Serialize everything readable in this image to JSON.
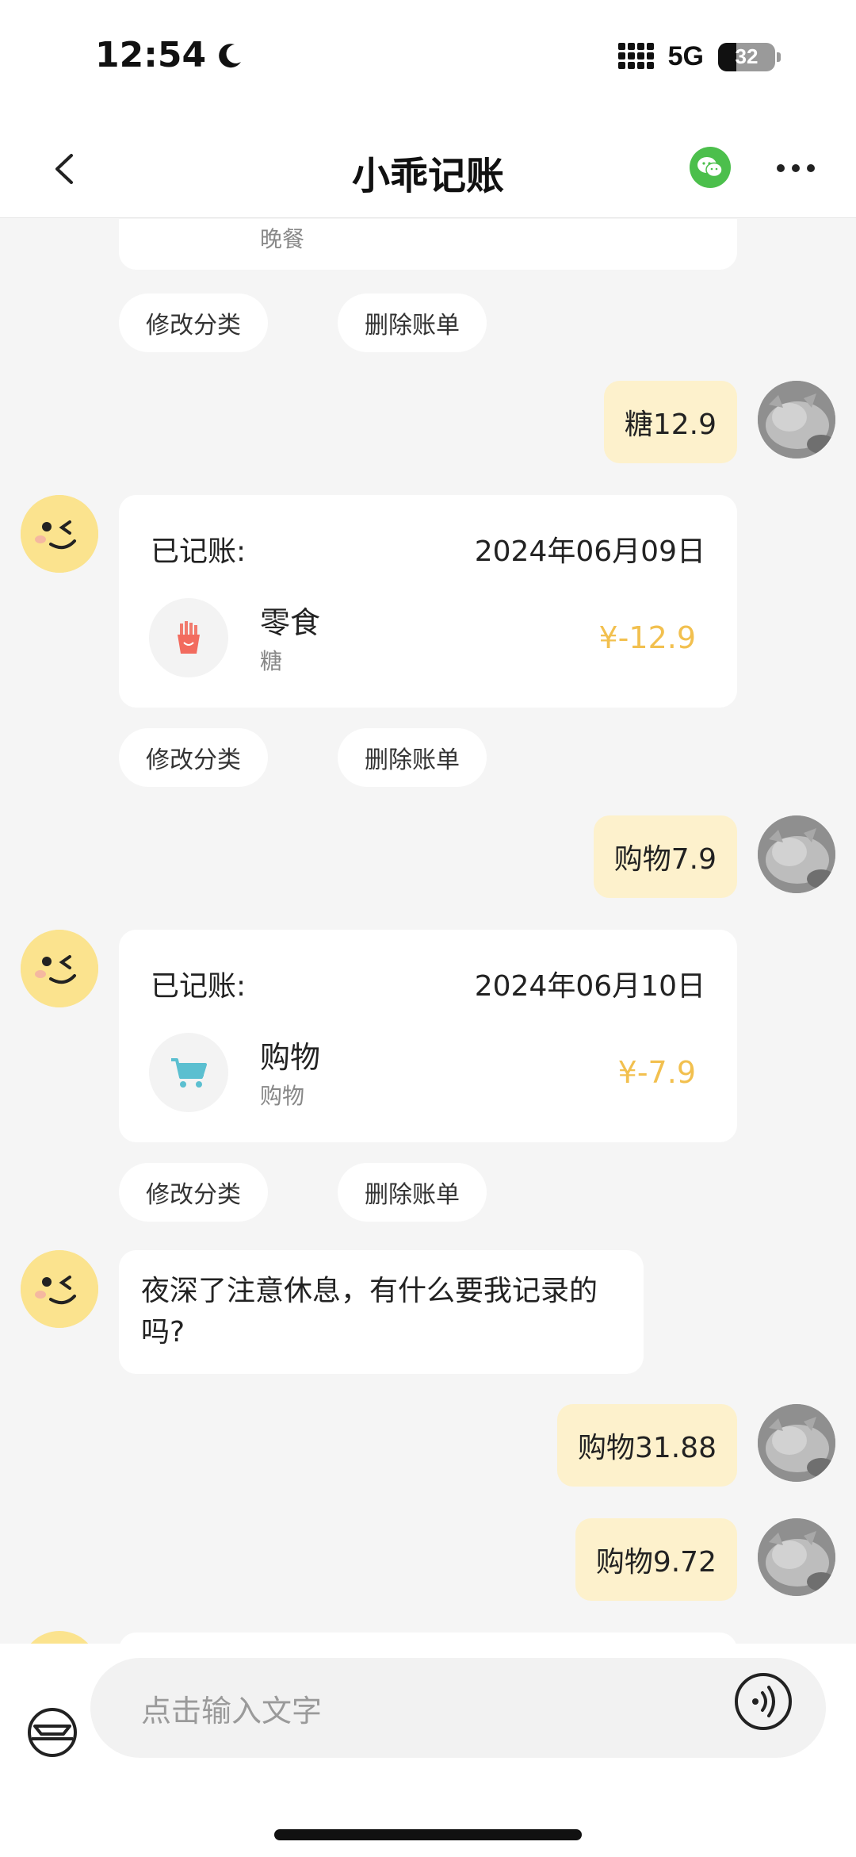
{
  "status_bar": {
    "time": "12:54",
    "network": "5G",
    "battery": "32",
    "battery_level": 0.32
  },
  "header": {
    "title": "小乖记账"
  },
  "messages": {
    "partial_card": {
      "sub": "晚餐"
    },
    "actions_1": {
      "edit": "修改分类",
      "delete": "删除账单"
    },
    "user_1": {
      "text": "糖12.9"
    },
    "card_1": {
      "label": "已记账:",
      "date": "2024年06月09日",
      "category": "零食",
      "note": "糖",
      "amount": "¥-12.9",
      "icon": "fries-icon"
    },
    "actions_2": {
      "edit": "修改分类",
      "delete": "删除账单"
    },
    "user_2": {
      "text": "购物7.9"
    },
    "card_2": {
      "label": "已记账:",
      "date": "2024年06月10日",
      "category": "购物",
      "note": "购物",
      "amount": "¥-7.9",
      "icon": "shopping-cart-icon"
    },
    "actions_3": {
      "edit": "修改分类",
      "delete": "删除账单"
    },
    "bot_text": {
      "text": "夜深了注意休息，有什么要我记录的吗?"
    },
    "user_3": {
      "text": "购物31.88"
    },
    "user_4": {
      "text": "购物9.72"
    }
  },
  "input": {
    "placeholder": "点击输入文字"
  },
  "colors": {
    "amount": "#f2c04f",
    "user_bubble": "#fdf1cc",
    "bot_avatar": "#fbe38e",
    "wechat": "#4cbf4c"
  }
}
